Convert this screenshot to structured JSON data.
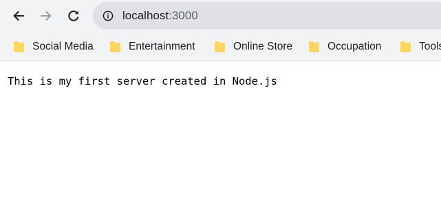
{
  "browser": {
    "address_bar": {
      "url_host": "localhost",
      "url_port": ":3000"
    },
    "icons": {
      "back": "arrow-left-icon",
      "forward": "arrow-right-icon",
      "reload": "reload-icon",
      "site_info": "info-circle-icon",
      "bookmark_folder": "folder-icon"
    },
    "bookmarks": [
      {
        "label": "Social Media"
      },
      {
        "label": "Entertainment"
      },
      {
        "label": "Online Store"
      },
      {
        "label": "Occupation"
      },
      {
        "label": "Tools"
      }
    ]
  },
  "page": {
    "body_text": "This is my first server created in Node.js"
  },
  "colors": {
    "toolbar_bg": "#f1f3f4",
    "omnibox_bg": "#dfe1e5",
    "folder_yellow": "#fcd663",
    "forward_disabled": "#9aa0a6"
  }
}
